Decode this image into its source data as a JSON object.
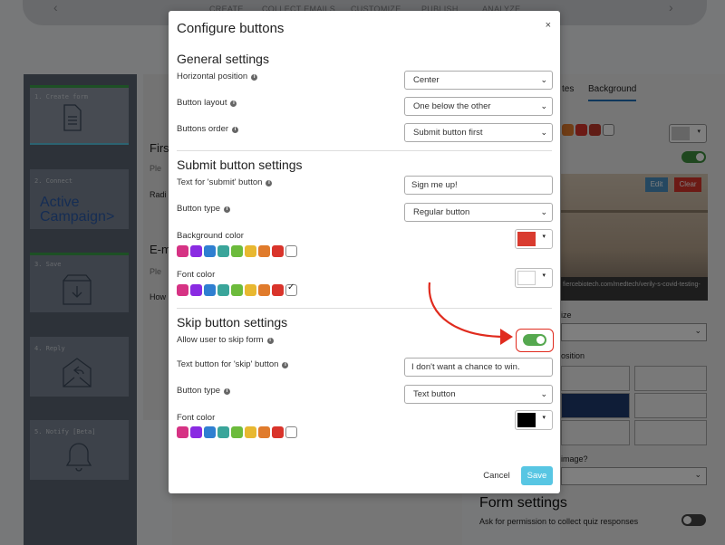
{
  "nav": {
    "items": [
      "CREATE",
      "COLLECT EMAILS",
      "CUSTOMIZE",
      "PUBLISH",
      "ANALYZE"
    ]
  },
  "steps": [
    {
      "label": "1. Create form",
      "icon": "document-icon"
    },
    {
      "label": "2. Connect",
      "logo_line1": "Active",
      "logo_line2": "Campaign",
      "logo_mark": ">"
    },
    {
      "label": "3. Save",
      "icon": "archive-download-icon"
    },
    {
      "label": "4. Reply",
      "icon": "envelope-reply-icon"
    },
    {
      "label": "5. Notify [Beta]",
      "icon": "bell-icon"
    }
  ],
  "background_panel": {
    "tab_partial": "tes",
    "tab_background": "Background",
    "edit": "Edit",
    "clear": "Clear",
    "photo_url": "fiercebiotech.com/medtech/verily-s-covid-testing-",
    "size_label": "ize",
    "position_label": "osition",
    "image_question": "image?",
    "form_settings_title": "Form settings",
    "form_settings_ask": "Ask for permission to collect quiz responses"
  },
  "mid_fragments": {
    "first": "Firs",
    "plea1": "Ple",
    "radio": "Radi",
    "email": "E-m",
    "plea2": "Ple",
    "how": "How"
  },
  "modal": {
    "title": "Configure buttons",
    "close": "×",
    "general": {
      "heading": "General settings",
      "horizontal_position_label": "Horizontal position",
      "horizontal_position_value": "Center",
      "button_layout_label": "Button layout",
      "button_layout_value": "One below the other",
      "buttons_order_label": "Buttons order",
      "buttons_order_value": "Submit button first"
    },
    "submit": {
      "heading": "Submit button settings",
      "text_label": "Text for 'submit' button",
      "text_value": "Sign me up!",
      "type_label": "Button type",
      "type_value": "Regular button",
      "bg_color_label": "Background color",
      "bg_color_value": "#d93b2f",
      "font_color_label": "Font color",
      "font_color_value": "#ffffff"
    },
    "skip": {
      "heading": "Skip button settings",
      "allow_label": "Allow user to skip form",
      "allow_enabled": true,
      "text_label": "Text button for 'skip' button",
      "text_value": "I don't want a chance to win.",
      "type_label": "Button type",
      "type_value": "Text button",
      "font_color_label": "Font color",
      "font_color_value": "#000000"
    },
    "palette": [
      "#d63384",
      "#8a2be2",
      "#2f7fd1",
      "#3aa59a",
      "#6cbb3c",
      "#e8b830",
      "#e07b2c",
      "#d9342b"
    ],
    "cancel": "Cancel",
    "save": "Save"
  },
  "colors": {
    "accent_save": "#58c6e3",
    "annotation_red": "#e02b1e",
    "toggle_on": "#55a84f"
  }
}
